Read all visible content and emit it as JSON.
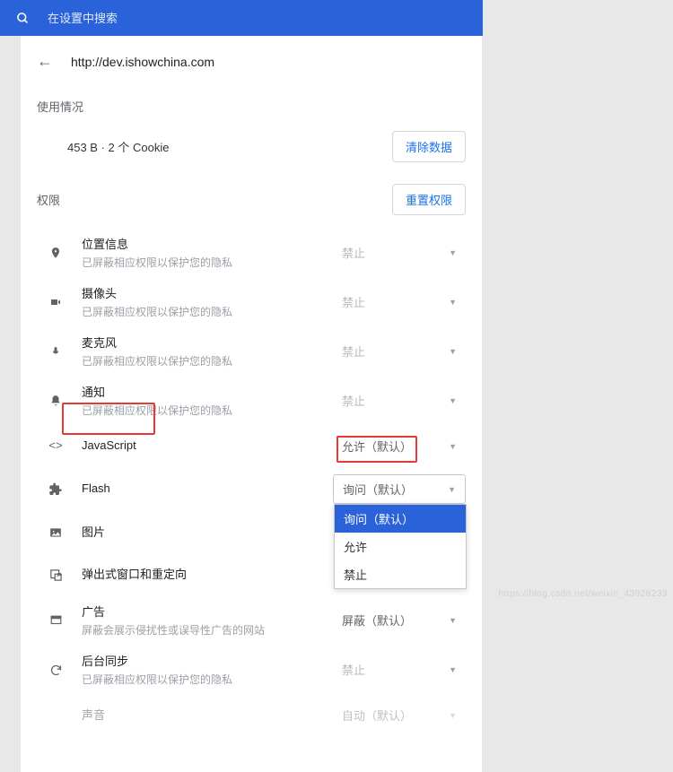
{
  "search": {
    "placeholder": "在设置中搜索"
  },
  "header": {
    "url": "http://dev.ishowchina.com"
  },
  "usage": {
    "label": "使用情况",
    "text": "453 B · 2 个 Cookie",
    "clear_button": "清除数据"
  },
  "permissions": {
    "label": "权限",
    "reset_button": "重置权限",
    "disabled_desc": "已屏蔽相应权限以保护您的隐私",
    "value_block": "禁止",
    "value_allow_default": "允许（默认）",
    "value_ask_default": "询问（默认）",
    "value_shield_default": "屏蔽（默认）",
    "value_auto_default": "自动（默认）",
    "items": {
      "location": {
        "title": "位置信息"
      },
      "camera": {
        "title": "摄像头"
      },
      "mic": {
        "title": "麦克风"
      },
      "notifications": {
        "title": "通知"
      },
      "javascript": {
        "title": "JavaScript"
      },
      "flash": {
        "title": "Flash"
      },
      "images": {
        "title": "图片"
      },
      "popups": {
        "title": "弹出式窗口和重定向"
      },
      "ads": {
        "title": "广告",
        "desc": "屏蔽会展示侵扰性或误导性广告的网站"
      },
      "bgsync": {
        "title": "后台同步"
      },
      "sound": {
        "title": "声音"
      }
    },
    "dropdown_options": {
      "ask_default": "询问（默认）",
      "allow": "允许",
      "block": "禁止"
    }
  },
  "watermark": "https://blog.csdn.net/weixin_43928233"
}
